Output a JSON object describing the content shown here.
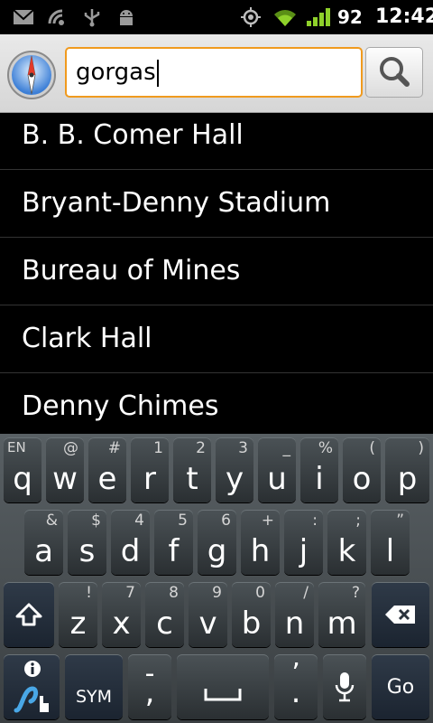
{
  "status_bar": {
    "battery": "92",
    "time": "12:42",
    "icons": [
      "gmail-icon",
      "wireless-icon",
      "usb-icon",
      "android-debug-icon",
      "gps-icon",
      "wifi-icon",
      "signal-icon",
      "battery-icon"
    ]
  },
  "search": {
    "query": "gorgas",
    "accent_color": "#f09a1e",
    "app_icon": "compass-icon",
    "button_icon": "magnifier-icon"
  },
  "suggestions": [
    "B. B. Comer Hall",
    "Bryant-Denny Stadium",
    "Bureau of Mines",
    "Clark Hall",
    "Denny Chimes"
  ],
  "keyboard": {
    "lang": "EN",
    "row1": [
      {
        "main": "q",
        "alt": ""
      },
      {
        "main": "w",
        "alt": "@"
      },
      {
        "main": "e",
        "alt": "#"
      },
      {
        "main": "r",
        "alt": "1"
      },
      {
        "main": "t",
        "alt": "2"
      },
      {
        "main": "y",
        "alt": "3"
      },
      {
        "main": "u",
        "alt": "_"
      },
      {
        "main": "i",
        "alt": "%"
      },
      {
        "main": "o",
        "alt": "("
      },
      {
        "main": "p",
        "alt": ")"
      }
    ],
    "row2": [
      {
        "main": "a",
        "alt": "&"
      },
      {
        "main": "s",
        "alt": "$"
      },
      {
        "main": "d",
        "alt": "4"
      },
      {
        "main": "f",
        "alt": "5"
      },
      {
        "main": "g",
        "alt": "6"
      },
      {
        "main": "h",
        "alt": "+"
      },
      {
        "main": "j",
        "alt": ":"
      },
      {
        "main": "k",
        "alt": ";"
      },
      {
        "main": "l",
        "alt": "”"
      }
    ],
    "row3": [
      {
        "main": "z",
        "alt": "!"
      },
      {
        "main": "x",
        "alt": "7"
      },
      {
        "main": "c",
        "alt": "8"
      },
      {
        "main": "v",
        "alt": "9"
      },
      {
        "main": "b",
        "alt": "0"
      },
      {
        "main": "n",
        "alt": "/"
      },
      {
        "main": "m",
        "alt": "?"
      }
    ],
    "sym_label": "SYM",
    "comma_main": ",",
    "comma_alt": "-",
    "period_main": ".",
    "period_alt": "’",
    "go_label": "Go"
  }
}
